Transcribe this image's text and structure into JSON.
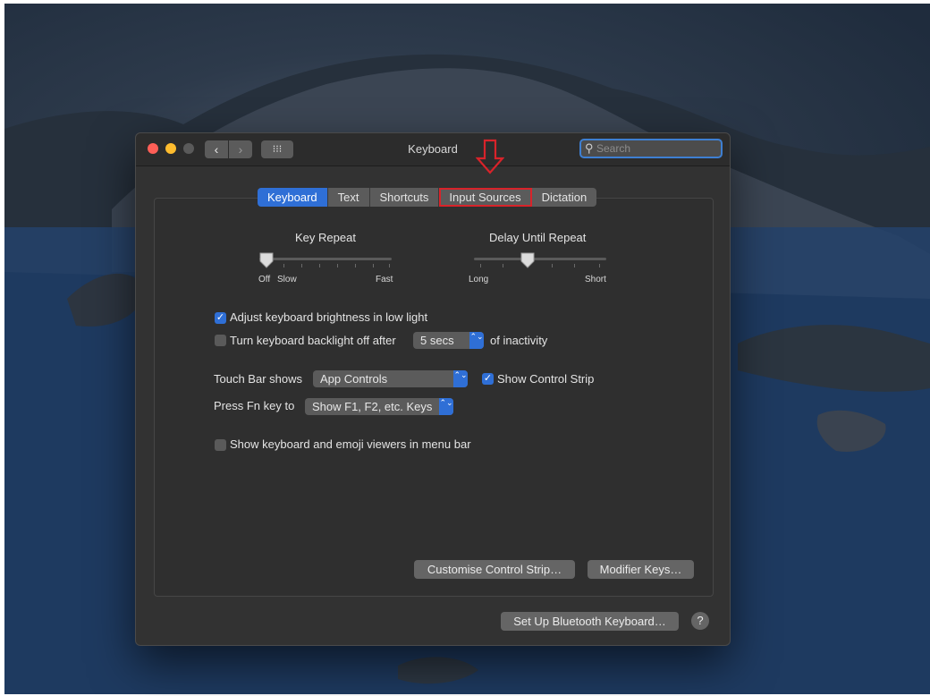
{
  "window": {
    "title": "Keyboard",
    "nav": {
      "back": "‹",
      "forward": "›",
      "grid": "⁝⁝⁝"
    },
    "search": {
      "placeholder": "Search",
      "value": ""
    }
  },
  "tabs": [
    {
      "label": "Keyboard",
      "active": true
    },
    {
      "label": "Text"
    },
    {
      "label": "Shortcuts"
    },
    {
      "label": "Input Sources",
      "highlighted": true
    },
    {
      "label": "Dictation"
    }
  ],
  "key_repeat": {
    "title": "Key Repeat",
    "off": "Off",
    "slow": "Slow",
    "fast": "Fast"
  },
  "delay_until_repeat": {
    "title": "Delay Until Repeat",
    "long": "Long",
    "short": "Short"
  },
  "options": {
    "brightness": {
      "label": "Adjust keyboard brightness in low light",
      "checked": true
    },
    "backlight": {
      "label": "Turn keyboard backlight off after",
      "value": "5 secs",
      "suffix": "of inactivity",
      "checked": false
    },
    "touch_bar": {
      "label": "Touch Bar shows",
      "value": "App Controls",
      "control_strip_label": "Show Control Strip",
      "control_strip_checked": true
    },
    "fn_key": {
      "label": "Press Fn key to",
      "value": "Show F1, F2, etc. Keys"
    },
    "viewers": {
      "label": "Show keyboard and emoji viewers in menu bar",
      "checked": false
    }
  },
  "buttons": {
    "customise": "Customise Control Strip…",
    "modifier": "Modifier Keys…",
    "bluetooth": "Set Up Bluetooth Keyboard…",
    "help": "?"
  },
  "icons": {
    "check": "✓",
    "stepper": "⌃⌄",
    "search": "search-icon"
  },
  "colors": {
    "accent": "#2f6fd6",
    "annotation": "#d8232a"
  }
}
